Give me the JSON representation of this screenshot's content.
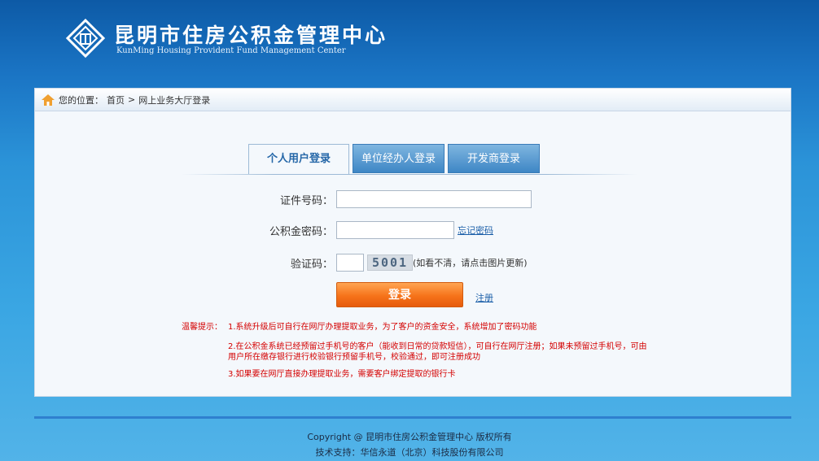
{
  "header": {
    "title_cn": "昆明市住房公积金管理中心",
    "title_en": "KunMing Housing Provident Fund Management Center"
  },
  "breadcrumb": {
    "prefix": "您的位置：",
    "home": "首页",
    "separator": ">",
    "current": "网上业务大厅登录"
  },
  "tabs": [
    {
      "label": "个人用户登录",
      "active": true
    },
    {
      "label": "单位经办人登录",
      "active": false
    },
    {
      "label": "开发商登录",
      "active": false
    }
  ],
  "form": {
    "id_label": "证件号码：",
    "id_value": "",
    "password_label": "公积金密码：",
    "password_value": "",
    "forgot_password": "忘记密码",
    "captcha_label": "验证码：",
    "captcha_value": "",
    "captcha_image_text": "5001",
    "captcha_hint": "(如看不清，请点击图片更新)",
    "login_button": "登录",
    "register_link": "注册"
  },
  "tips": {
    "heading": "温馨提示：",
    "items": [
      "1.系统升级后可自行在网厅办理提取业务，为了客户的资金安全，系统增加了密码功能",
      "2.在公积金系统已经预留过手机号的客户（能收到日常的贷款短信），可自行在网厅注册；如果未预留过手机号，可由用户所在缴存银行进行校验银行预留手机号，校验通过，即可注册成功",
      "3.如果要在网厅直接办理提取业务，需要客户绑定提取的银行卡"
    ]
  },
  "footer": {
    "copyright": "Copyright @ 昆明市住房公积金管理中心 版权所有",
    "support": "技术支持：华信永道（北京）科技股份有限公司"
  },
  "colors": {
    "brand_blue": "#1a74c4",
    "tab_active_text": "#2567a8",
    "login_orange": "#f6731a",
    "tips_red": "#d40000"
  }
}
